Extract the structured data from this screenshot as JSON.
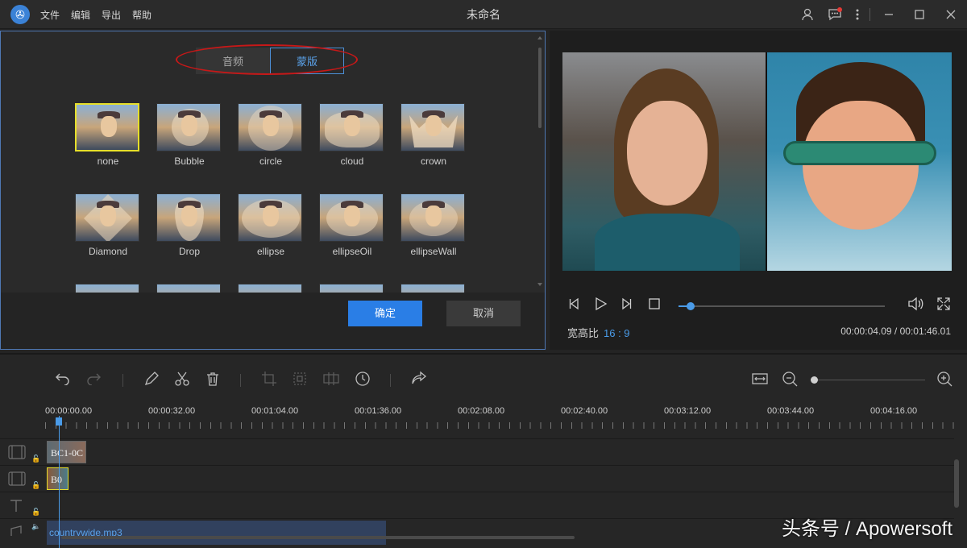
{
  "app": {
    "title": "未命名",
    "menu": [
      "文件",
      "编辑",
      "导出",
      "帮助"
    ],
    "logo_icon": "film-reel-icon"
  },
  "titlebar_icons": [
    "user-icon",
    "message-icon",
    "more-icon",
    "minimize-icon",
    "maximize-icon",
    "close-icon"
  ],
  "mask_panel": {
    "tabs": [
      {
        "label": "音频",
        "active": false
      },
      {
        "label": "蒙版",
        "active": true
      }
    ],
    "masks": [
      {
        "label": "none",
        "selected": true
      },
      {
        "label": "Bubble",
        "selected": false
      },
      {
        "label": "circle",
        "selected": false
      },
      {
        "label": "cloud",
        "selected": false
      },
      {
        "label": "crown",
        "selected": false
      },
      {
        "label": "Diamond",
        "selected": false
      },
      {
        "label": "Drop",
        "selected": false
      },
      {
        "label": "ellipse",
        "selected": false
      },
      {
        "label": "ellipseOil",
        "selected": false
      },
      {
        "label": "ellipseWall",
        "selected": false
      }
    ],
    "ok_label": "确定",
    "cancel_label": "取消",
    "highlight_color": "#c71818",
    "accent": "#2a7ee6"
  },
  "preview": {
    "aspect_label": "宽高比",
    "aspect_value": "16 : 9",
    "time_display": "00:00:04.09 / 00:01:46.01",
    "progress": 0.06
  },
  "timeline": {
    "ruler_labels": [
      "00:00:00.00",
      "00:00:32.00",
      "00:01:04.00",
      "00:01:36.00",
      "00:02:08.00",
      "00:02:40.00",
      "00:03:12.00",
      "00:03:44.00",
      "00:04:16.00"
    ],
    "clips": {
      "video1": "BC1-0C",
      "video2": "B0",
      "audio": "countrywide.mp3"
    },
    "zoom": 0.0
  },
  "watermark": "头条号 / Apowersoft"
}
